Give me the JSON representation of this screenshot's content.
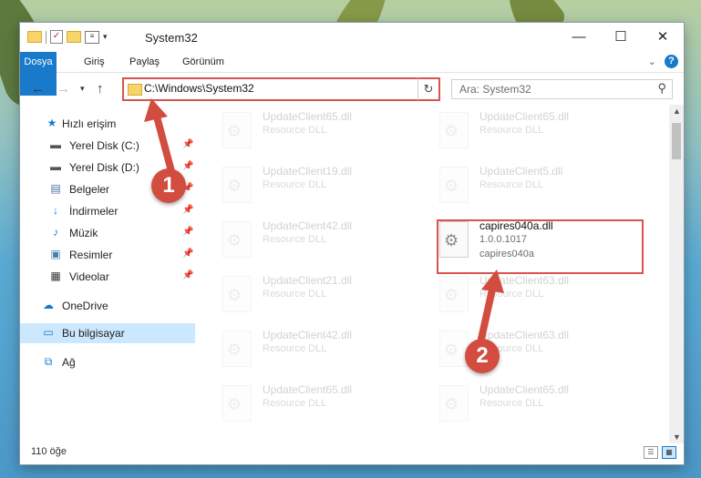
{
  "window": {
    "title": "System32",
    "minimize": "—",
    "maximize": "☐",
    "close": "✕"
  },
  "ribbon": {
    "tabs": [
      "Dosya",
      "Giriş",
      "Paylaş",
      "Görünüm"
    ],
    "help": "?"
  },
  "address": {
    "path": "C:\\Windows\\System32",
    "search_placeholder": "Ara: System32"
  },
  "sidebar": {
    "items": [
      {
        "label": "Hızlı erişim",
        "icon": "star-icon",
        "pinned": false
      },
      {
        "label": "Yerel Disk (C:)",
        "icon": "drive-icon",
        "pinned": true
      },
      {
        "label": "Yerel Disk (D:)",
        "icon": "drive-icon",
        "pinned": true
      },
      {
        "label": "Belgeler",
        "icon": "documents-icon",
        "pinned": true
      },
      {
        "label": "İndirmeler",
        "icon": "downloads-icon",
        "pinned": true
      },
      {
        "label": "Müzik",
        "icon": "music-icon",
        "pinned": true
      },
      {
        "label": "Resimler",
        "icon": "pictures-icon",
        "pinned": true
      },
      {
        "label": "Videolar",
        "icon": "videos-icon",
        "pinned": true
      },
      {
        "label": "OneDrive",
        "icon": "onedrive-icon",
        "pinned": false
      },
      {
        "label": "Bu bilgisayar",
        "icon": "computer-icon",
        "pinned": false,
        "selected": true
      },
      {
        "label": "Ağ",
        "icon": "network-icon",
        "pinned": false
      }
    ]
  },
  "files": [
    {
      "name": "UpdateClient65.dll",
      "type": "Resource DLL"
    },
    {
      "name": "UpdateClient65.dll",
      "type": "Resource DLL"
    },
    {
      "name": "UpdateClient19.dll",
      "type": "Resource DLL"
    },
    {
      "name": "UpdateClient5.dll",
      "type": "Resource DLL"
    },
    {
      "name": "UpdateClient42.dll",
      "type": "Resource DLL"
    },
    {
      "name": "capires040a.dll",
      "version": "1.0.0.1017",
      "desc": "capires040a"
    },
    {
      "name": "UpdateClient21.dll",
      "type": "Resource DLL"
    },
    {
      "name": "UpdateClient63.dll",
      "type": "Resource DLL"
    },
    {
      "name": "UpdateClient42.dll",
      "type": "Resource DLL"
    },
    {
      "name": "UpdateClient63.dll",
      "type": "Resource DLL"
    },
    {
      "name": "UpdateClient65.dll",
      "type": "Resource DLL"
    },
    {
      "name": "UpdateClient65.dll",
      "type": "Resource DLL"
    }
  ],
  "status": {
    "count": "110 öğe"
  },
  "annotations": {
    "step1": "1",
    "step2": "2",
    "color": "#d9534f"
  }
}
